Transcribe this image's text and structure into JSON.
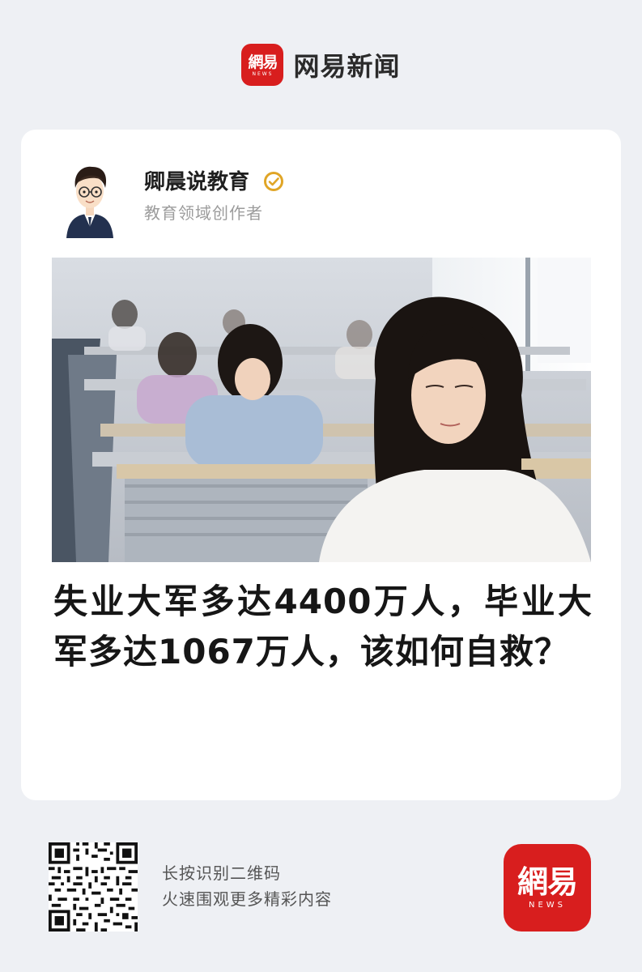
{
  "app": {
    "brand_logo_text": "網易",
    "brand_logo_subtext": "NEWS",
    "brand_name": "网易新闻"
  },
  "author": {
    "name": "卿晨说教育",
    "description": "教育领域创作者",
    "verified_icon": "verified-badge-icon"
  },
  "article": {
    "image_alt": "classroom-exam-photo",
    "headline": "失业大军多达4400万人，毕业大军多达1067万人，该如何自救？"
  },
  "footer": {
    "qr_line1": "长按识别二维码",
    "qr_line2": "火速围观更多精彩内容",
    "logo_text": "網易",
    "logo_subtext": "NEWS"
  },
  "colors": {
    "brand_red": "#d81e1e",
    "page_bg": "#eef0f4",
    "verified_gold": "#e0a526"
  }
}
